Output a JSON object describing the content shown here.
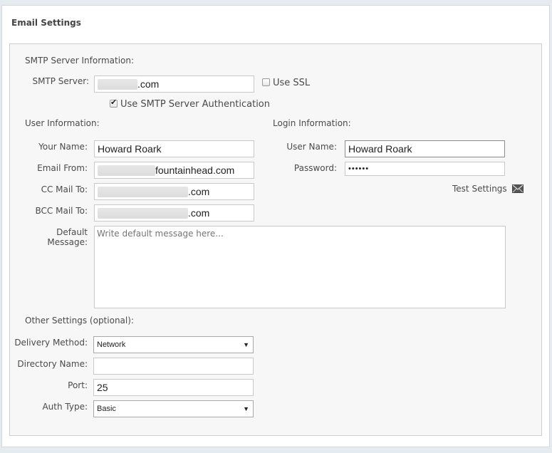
{
  "panel": {
    "title": "Email Settings"
  },
  "smtp": {
    "section_label": "SMTP Server Information:",
    "server_label": "SMTP Server:",
    "server_value_suffix": ".com",
    "use_ssl_label": "Use SSL",
    "use_ssl_checked": false,
    "auth_label": "Use SMTP Server Authentication",
    "auth_checked": true
  },
  "user": {
    "section_label": "User Information:",
    "name_label": "Your Name:",
    "name_value": "Howard Roark",
    "from_label": "Email From:",
    "from_value_suffix": "fountainhead.com",
    "cc_label": "CC Mail To:",
    "cc_value_suffix": ".com",
    "bcc_label": "BCC Mail To:",
    "bcc_value_suffix": ".com"
  },
  "login": {
    "section_label": "Login Information:",
    "username_label": "User Name:",
    "username_value": "Howard Roark",
    "password_label": "Password:",
    "password_value": "••••••",
    "test_settings_label": "Test Settings"
  },
  "message": {
    "label": "Default Message:",
    "placeholder": "Write default message here..."
  },
  "other": {
    "section_label": "Other Settings (optional):",
    "delivery_label": "Delivery Method:",
    "delivery_value": "Network",
    "directory_label": "Directory Name:",
    "directory_value": "",
    "port_label": "Port:",
    "port_value": "25",
    "auth_type_label": "Auth Type:",
    "auth_type_value": "Basic"
  },
  "icons": {
    "test_settings": "envelope-icon",
    "dropdown": "chevron-down-icon"
  }
}
